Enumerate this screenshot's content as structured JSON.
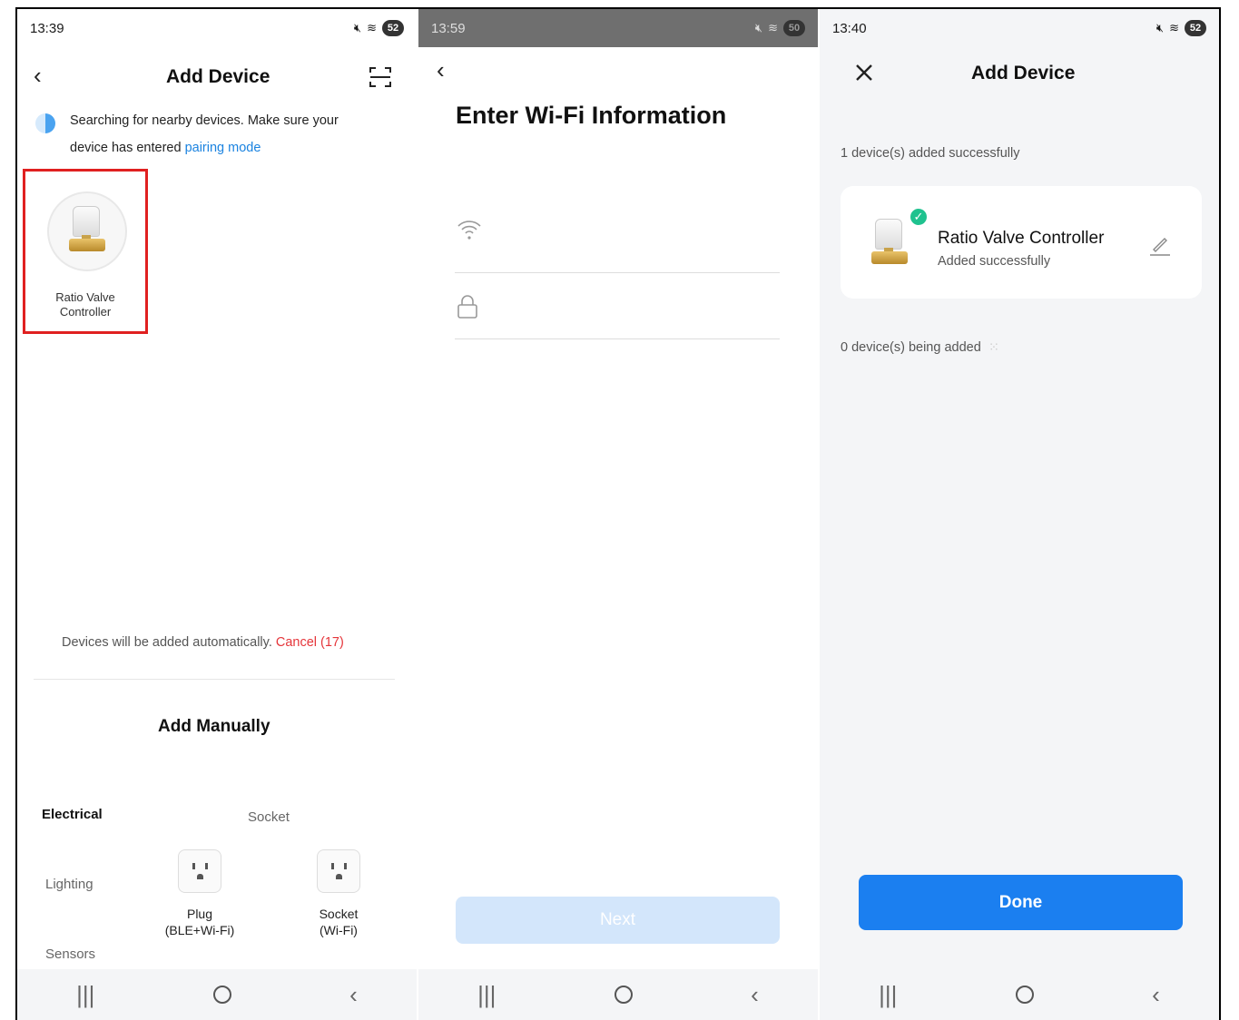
{
  "panel1": {
    "time": "13:39",
    "battery": "52",
    "title": "Add Device",
    "search_text": "Searching for nearby devices. Make sure your device has entered ",
    "pairing_link": "pairing mode",
    "device": {
      "name_line1": "Ratio Valve",
      "name_line2": "Controller"
    },
    "auto_text": "Devices will be added automatically. ",
    "cancel_text": "Cancel (17)",
    "add_manually": "Add Manually",
    "categories": [
      "Electrical",
      "Lighting",
      "Sensors"
    ],
    "section_label": "Socket",
    "items": [
      {
        "line1": "Plug",
        "line2": "(BLE+Wi-Fi)"
      },
      {
        "line1": "Socket",
        "line2": "(Wi-Fi)"
      }
    ]
  },
  "panel2": {
    "time": "13:59",
    "battery": "50",
    "title": "Enter Wi-Fi Information",
    "next_label": "Next"
  },
  "panel3": {
    "time": "13:40",
    "battery": "52",
    "title": "Add Device",
    "success_count": "1 device(s) added successfully",
    "device_name": "Ratio Valve Controller",
    "device_status": "Added successfully",
    "pending_count": "0 device(s) being added",
    "done_label": "Done"
  },
  "colors": {
    "accent": "#1b7ff0",
    "link": "#1b83e0",
    "cancel": "#e5353a",
    "success": "#1fc28f",
    "highlight_box": "#e02020"
  }
}
